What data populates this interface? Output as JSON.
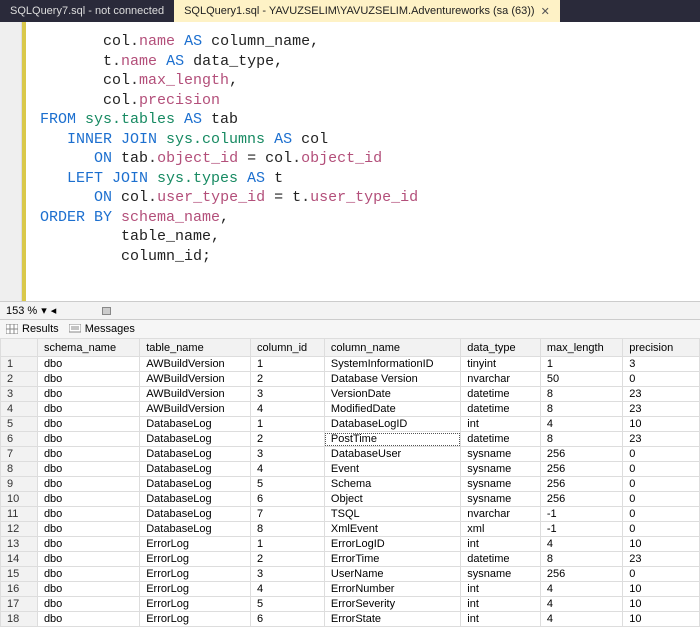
{
  "tabs": [
    {
      "label": "SQLQuery7.sql - not connected",
      "active": false
    },
    {
      "label": "SQLQuery1.sql - YAVUZSELIM\\YAVUZSELIM.Adventureworks (sa (63))",
      "active": true
    }
  ],
  "zoom": {
    "percent": "153 %"
  },
  "result_tabs": {
    "results": "Results",
    "messages": "Messages"
  },
  "columns": [
    "",
    "schema_name",
    "table_name",
    "column_id",
    "column_name",
    "data_type",
    "max_length",
    "precision"
  ],
  "selected_cell": {
    "row": 6,
    "col": 4
  },
  "rows": [
    [
      "1",
      "dbo",
      "AWBuildVersion",
      "1",
      "SystemInformationID",
      "tinyint",
      "1",
      "3"
    ],
    [
      "2",
      "dbo",
      "AWBuildVersion",
      "2",
      "Database Version",
      "nvarchar",
      "50",
      "0"
    ],
    [
      "3",
      "dbo",
      "AWBuildVersion",
      "3",
      "VersionDate",
      "datetime",
      "8",
      "23"
    ],
    [
      "4",
      "dbo",
      "AWBuildVersion",
      "4",
      "ModifiedDate",
      "datetime",
      "8",
      "23"
    ],
    [
      "5",
      "dbo",
      "DatabaseLog",
      "1",
      "DatabaseLogID",
      "int",
      "4",
      "10"
    ],
    [
      "6",
      "dbo",
      "DatabaseLog",
      "2",
      "PostTime",
      "datetime",
      "8",
      "23"
    ],
    [
      "7",
      "dbo",
      "DatabaseLog",
      "3",
      "DatabaseUser",
      "sysname",
      "256",
      "0"
    ],
    [
      "8",
      "dbo",
      "DatabaseLog",
      "4",
      "Event",
      "sysname",
      "256",
      "0"
    ],
    [
      "9",
      "dbo",
      "DatabaseLog",
      "5",
      "Schema",
      "sysname",
      "256",
      "0"
    ],
    [
      "10",
      "dbo",
      "DatabaseLog",
      "6",
      "Object",
      "sysname",
      "256",
      "0"
    ],
    [
      "11",
      "dbo",
      "DatabaseLog",
      "7",
      "TSQL",
      "nvarchar",
      "-1",
      "0"
    ],
    [
      "12",
      "dbo",
      "DatabaseLog",
      "8",
      "XmlEvent",
      "xml",
      "-1",
      "0"
    ],
    [
      "13",
      "dbo",
      "ErrorLog",
      "1",
      "ErrorLogID",
      "int",
      "4",
      "10"
    ],
    [
      "14",
      "dbo",
      "ErrorLog",
      "2",
      "ErrorTime",
      "datetime",
      "8",
      "23"
    ],
    [
      "15",
      "dbo",
      "ErrorLog",
      "3",
      "UserName",
      "sysname",
      "256",
      "0"
    ],
    [
      "16",
      "dbo",
      "ErrorLog",
      "4",
      "ErrorNumber",
      "int",
      "4",
      "10"
    ],
    [
      "17",
      "dbo",
      "ErrorLog",
      "5",
      "ErrorSeverity",
      "int",
      "4",
      "10"
    ],
    [
      "18",
      "dbo",
      "ErrorLog",
      "6",
      "ErrorState",
      "int",
      "4",
      "10"
    ]
  ],
  "sql": {
    "l1a": "col",
    "l1b": ".",
    "l1c": "name",
    "l1d": " AS ",
    "l1e": "column_name",
    "l1f": ",",
    "l2a": "t",
    "l2b": ".",
    "l2c": "name",
    "l2d": " AS ",
    "l2e": "data_type",
    "l2f": ",",
    "l3a": "col",
    "l3b": ".",
    "l3c": "max_length",
    "l3d": ",",
    "l4a": "col",
    "l4b": ".",
    "l4c": "precision",
    "l5a": "FROM ",
    "l5b": "sys.tables",
    "l5c": " AS ",
    "l5d": "tab",
    "l6a": "INNER JOIN ",
    "l6b": "sys.columns",
    "l6c": " AS ",
    "l6d": "col",
    "l7a": "ON ",
    "l7b": "tab",
    "l7c": ".",
    "l7d": "object_id",
    "l7e": " = ",
    "l7f": "col",
    "l7g": ".",
    "l7h": "object_id",
    "l8a": "LEFT JOIN ",
    "l8b": "sys.types",
    "l8c": " AS ",
    "l8d": "t",
    "l9a": "ON ",
    "l9b": "col",
    "l9c": ".",
    "l9d": "user_type_id",
    "l9e": " = ",
    "l9f": "t",
    "l9g": ".",
    "l9h": "user_type_id",
    "l10a": "ORDER BY ",
    "l10b": "schema_name",
    "l10c": ",",
    "l11a": "table_name",
    "l11b": ",",
    "l12a": "column_id",
    "l12b": ";"
  }
}
